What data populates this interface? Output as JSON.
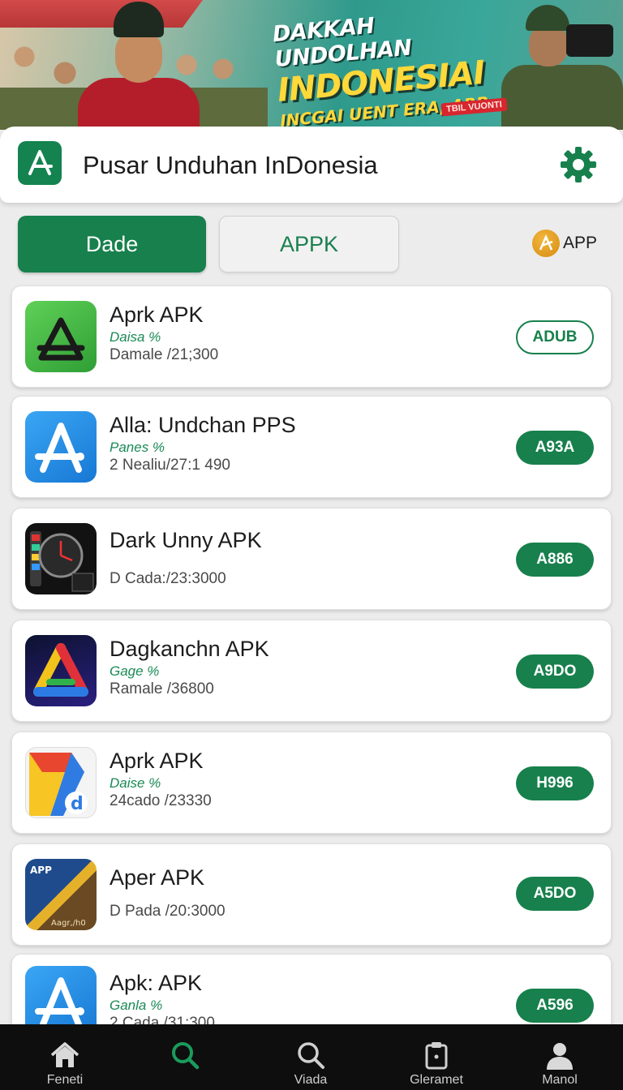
{
  "banner": {
    "line1": "DAKKAH UNDOLHAN",
    "line2": "INDONESIAI",
    "line3": "INCGAI UENT ERA, ARP",
    "stamp": "TBIL VUONTI"
  },
  "header": {
    "title": "Pusar Unduhan InDonesia"
  },
  "tabs": [
    {
      "label": "Dade",
      "active": true
    },
    {
      "label": "APPK",
      "active": false
    }
  ],
  "app_chip": {
    "label": "APP"
  },
  "apps": [
    {
      "name": "Aprk APK",
      "sub": "Daisa %",
      "meta": "Damale /21;300",
      "action": "ADUB",
      "style": "outline"
    },
    {
      "name": "Alla: Undchan PPS",
      "sub": "Panes %",
      "meta": "2 Nealiu/27:1 490",
      "action": "A93A",
      "style": "filled"
    },
    {
      "name": "Dark Unny APK",
      "sub": "",
      "meta": "D Cada:/23:3000",
      "action": "A886",
      "style": "filled"
    },
    {
      "name": "Dagkanchn APK",
      "sub": "Gage %",
      "meta": "Ramale /36800",
      "action": "A9DO",
      "style": "filled"
    },
    {
      "name": "Aprk APK",
      "sub": "Daise %",
      "meta": "24cado /23330",
      "action": "H996",
      "style": "filled"
    },
    {
      "name": "Aper APK",
      "sub": "",
      "meta": "D Pada /20:3000",
      "action": "A5DO",
      "style": "filled"
    },
    {
      "name": "Apk: APK",
      "sub": "Ganla %",
      "meta": "2 Cada /31:300",
      "action": "A596",
      "style": "filled"
    }
  ],
  "icon_text": {
    "aper_top": "APP",
    "aper_bottom": "Aagr,/h0"
  },
  "bottom_nav": [
    {
      "label": "Feneti",
      "icon": "home-icon"
    },
    {
      "label": "",
      "icon": "search-icon-active"
    },
    {
      "label": "Viada",
      "icon": "search-icon"
    },
    {
      "label": "Gleramet",
      "icon": "clipboard-icon"
    },
    {
      "label": "Manol",
      "icon": "profile-icon"
    }
  ],
  "colors": {
    "brand_green": "#17804c",
    "background": "#ececec"
  }
}
